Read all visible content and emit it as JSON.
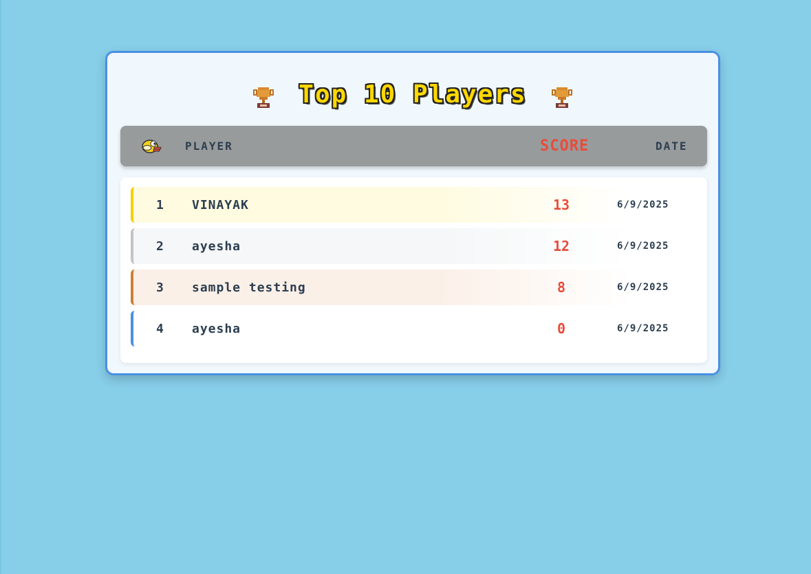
{
  "title": "Top 10 Players",
  "header": {
    "player": "PLAYER",
    "score": "SCORE",
    "date": "DATE"
  },
  "rows": [
    {
      "rank": "1",
      "name": "VINAYAK",
      "score": "13",
      "date": "6/9/2025",
      "accent": "#f5d000",
      "tint": "#fffbe0"
    },
    {
      "rank": "2",
      "name": "ayesha",
      "score": "12",
      "date": "6/9/2025",
      "accent": "#c4c4c4",
      "tint": "#f5f7f8"
    },
    {
      "rank": "3",
      "name": "sample testing",
      "score": "8",
      "date": "6/9/2025",
      "accent": "#cd8032",
      "tint": "#fbf0e8"
    },
    {
      "rank": "4",
      "name": "ayesha",
      "score": "0",
      "date": "6/9/2025",
      "accent": "#4a90e2",
      "tint": "#ffffff"
    }
  ],
  "icons": {
    "trophy": "trophy-icon",
    "bird": "bird-icon"
  },
  "colors": {
    "background": "#87cee9",
    "panel_border": "#4a90e2",
    "title": "#ffd800",
    "score": "#e74c3c",
    "header_bar": "#989b9b"
  }
}
